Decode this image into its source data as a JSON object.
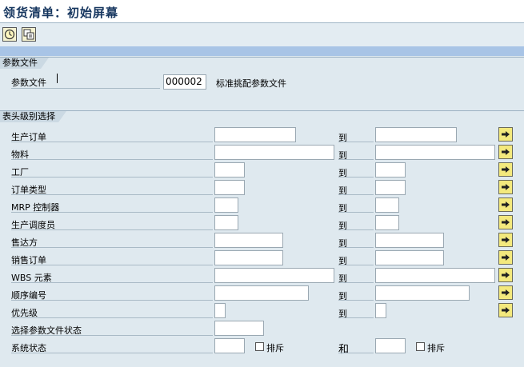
{
  "window": {
    "title": "领货清单：初始屏幕"
  },
  "toolbar": {
    "buttons": [
      {
        "icon": "execute-clock-icon"
      },
      {
        "icon": "copy-variant-icon"
      }
    ]
  },
  "param_group": {
    "title": "参数文件",
    "label": "参数文件",
    "value": "000002",
    "description": "标准挑配参数文件"
  },
  "header_group": {
    "title": "表头级别选择",
    "rows": [
      {
        "label": "生产订单",
        "to": "到"
      },
      {
        "label": "物料",
        "to": "到"
      },
      {
        "label": "工厂",
        "to": "到"
      },
      {
        "label": "订单类型",
        "to": "到"
      },
      {
        "label": "MRP 控制器",
        "to": "到"
      },
      {
        "label": "生产调度员",
        "to": "到"
      },
      {
        "label": "售达方",
        "to": "到"
      },
      {
        "label": "销售订单",
        "to": "到"
      },
      {
        "label": "WBS 元素",
        "to": "到"
      },
      {
        "label": "顺序编号",
        "to": "到"
      },
      {
        "label": "优先级",
        "to": "到"
      },
      {
        "label": "选择参数文件状态"
      },
      {
        "label": "系统状态",
        "exclude_label": "排斥",
        "and_label": "和",
        "exclude_label2": "排斥"
      }
    ]
  }
}
